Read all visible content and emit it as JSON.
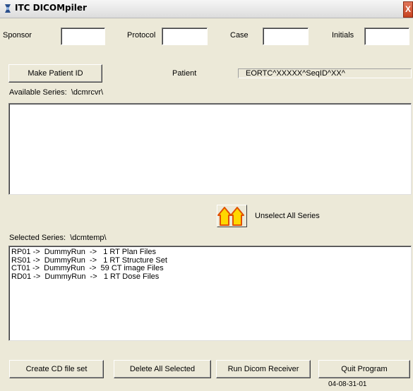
{
  "window": {
    "title": "ITC DICOMpiler",
    "close_glyph": "X"
  },
  "fields": {
    "sponsor": {
      "label": "Sponsor",
      "value": ""
    },
    "protocol": {
      "label": "Protocol",
      "value": ""
    },
    "case": {
      "label": "Case",
      "value": ""
    },
    "initials": {
      "label": "Initials",
      "value": ""
    }
  },
  "patient": {
    "button_label": "Make Patient ID",
    "label": "Patient",
    "value": "EORTC^XXXXX^SeqID^XX^"
  },
  "available": {
    "label": "Available Series:",
    "path": "\\dcmrcvr\\",
    "items": []
  },
  "unselect": {
    "icon": "double-up-arrow-icon",
    "label": "Unselect All Series"
  },
  "selected": {
    "label": "Selected Series:",
    "path": "\\dcmtemp\\",
    "items": [
      "RP01 ->  DummyRun  ->   1 RT Plan Files",
      "RS01 ->  DummyRun  ->   1 RT Structure Set",
      "CT01 ->  DummyRun  ->  59 CT image Files",
      "RD01 ->  DummyRun  ->   1 RT Dose Files"
    ]
  },
  "buttons": {
    "create_cd": "Create CD file set",
    "delete_all": "Delete All Selected",
    "run_receiver": "Run Dicom Receiver",
    "quit": "Quit Program"
  },
  "version": "04-08-31-01",
  "colors": {
    "window_bg": "#ece9d8",
    "arrow_fill": "#ffd800",
    "arrow_outline": "#e05000"
  }
}
